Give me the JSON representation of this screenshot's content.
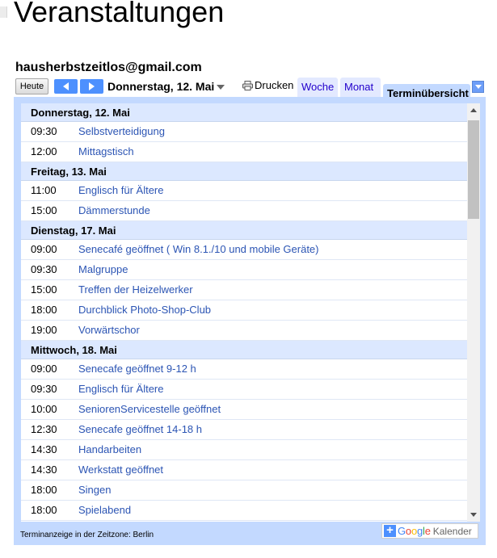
{
  "page": {
    "title": "Veranstaltungen"
  },
  "calendar": {
    "account": "hausherbstzeitlos@gmail.com",
    "toolbar": {
      "today_label": "Heute",
      "current_date": "Donnerstag, 12. Mai",
      "print_label": "Drucken",
      "tabs": [
        {
          "label": "Woche",
          "active": false
        },
        {
          "label": "Monat",
          "active": false
        },
        {
          "label": "Terminübersicht",
          "active": true
        }
      ]
    },
    "days": [
      {
        "header": "Donnerstag, 12. Mai",
        "events": [
          {
            "time": "09:30",
            "title": "Selbstverteidigung"
          },
          {
            "time": "12:00",
            "title": "Mittagstisch"
          }
        ]
      },
      {
        "header": "Freitag, 13. Mai",
        "events": [
          {
            "time": "11:00",
            "title": "Englisch für Ältere"
          },
          {
            "time": "15:00",
            "title": "Dämmerstunde"
          }
        ]
      },
      {
        "header": "Dienstag, 17. Mai",
        "events": [
          {
            "time": "09:00",
            "title": "Senecafé geöffnet ( Win 8.1./10 und mobile Geräte)"
          },
          {
            "time": "09:30",
            "title": "Malgruppe"
          },
          {
            "time": "15:00",
            "title": "Treffen der Heizelwerker"
          },
          {
            "time": "18:00",
            "title": "Durchblick Photo-Shop-Club"
          },
          {
            "time": "19:00",
            "title": "Vorwärtschor"
          }
        ]
      },
      {
        "header": "Mittwoch, 18. Mai",
        "events": [
          {
            "time": "09:00",
            "title": "Senecafe geöffnet 9-12 h"
          },
          {
            "time": "09:30",
            "title": "Englisch für Ältere"
          },
          {
            "time": "10:00",
            "title": "SeniorenServicestelle geöffnet"
          },
          {
            "time": "12:30",
            "title": "Senecafe geöffnet 14-18 h"
          },
          {
            "time": "14:30",
            "title": "Handarbeiten"
          },
          {
            "time": "14:30",
            "title": "Werkstatt geöffnet"
          },
          {
            "time": "18:00",
            "title": "Singen"
          },
          {
            "time": "18:00",
            "title": "Spielabend"
          }
        ]
      }
    ],
    "footer": {
      "timezone_note": "Terminanzeige in der Zeitzone: Berlin",
      "badge_product": "Kalender"
    }
  },
  "icons": {
    "print": "printer-icon",
    "prev": "chevron-left-icon",
    "next": "chevron-right-icon",
    "add": "plus-icon"
  },
  "colors": {
    "accent_blue": "#4d90fe",
    "frame": "#c3d9ff",
    "day_header": "#dce8ff",
    "event_link": "#2c55b4",
    "tab_link": "#2200cc"
  }
}
